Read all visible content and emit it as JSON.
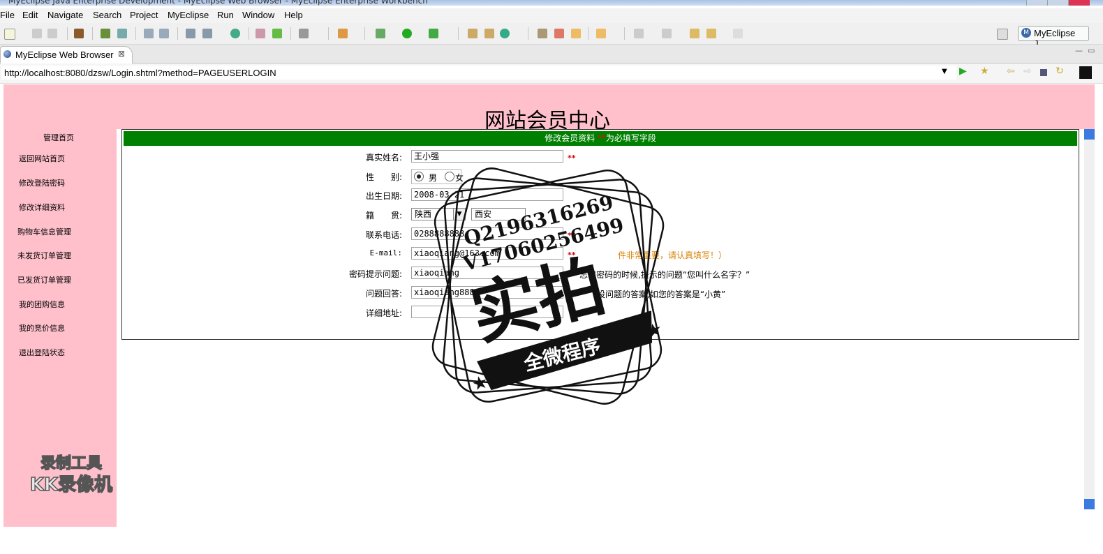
{
  "window": {
    "title": "MyEclipse Java Enterprise Development - MyEclipse Web Browser - MyEclipse Enterprise Workbench"
  },
  "menu": [
    "File",
    "Edit",
    "Navigate",
    "Search",
    "Project",
    "MyEclipse",
    "Run",
    "Window",
    "Help"
  ],
  "perspective": {
    "label": "MyEclipse J..."
  },
  "tab": {
    "label": "MyEclipse Web Browser",
    "close": "⊠"
  },
  "url": {
    "value": "http://localhost:8080/dzsw/Login.shtml?method=PAGEUSERLOGIN"
  },
  "site": {
    "title": "网站会员中心"
  },
  "sidebar": {
    "heading": "管理首页",
    "items": [
      "返回网站首页",
      "修改登陆密码",
      "修改详细资料",
      "购物车信息管理",
      "未发货订单管理",
      "已发货订单管理",
      "我的团购信息",
      "我的竞价信息",
      "退出登陆状态"
    ]
  },
  "form": {
    "header_text": "修改会员资料",
    "header_required_mark": "**",
    "header_suffix": "为必填写字段",
    "labels": {
      "name": "真实姓名:",
      "gender": "性　　别:",
      "birth": "出生日期:",
      "origin": "籍　　贯:",
      "phone": "联系电话:",
      "email": "E-mail:",
      "question": "密码提示问题:",
      "answer": "问题回答:",
      "address": "详细地址:"
    },
    "values": {
      "name": "王小强",
      "birth": "2008-03-21",
      "province": "陕西",
      "city": "西安",
      "phone": "0288888888",
      "email": "xiaoqiang@163.com",
      "question": "xiaoqiang",
      "answer": "xiaoqiang888",
      "address": ""
    },
    "gender_options": [
      "男",
      "女"
    ],
    "gender_selected": "男",
    "required_mark": "**",
    "hints": {
      "email": "件非常重要，请认真填写！）",
      "question": "忘记密码的时候,提示的问题“您叫什么名字？”",
      "answer": "设问题的答案,如您的答案是“小黄”"
    }
  },
  "watermark": {
    "qq": "Q2196316269",
    "wechat": "V17060256499",
    "big": "实拍",
    "banner": "全微程序",
    "tool_line1": "录制工具",
    "tool_line2": "KK录像机"
  },
  "colors": {
    "pink": "#ffc0cb",
    "green_header": "#008000",
    "required": "#cc0000"
  }
}
